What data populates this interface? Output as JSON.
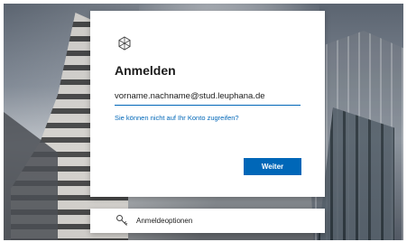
{
  "icons": {
    "logo": "org-logo-icon",
    "options": "key-icon"
  },
  "colors": {
    "accent": "#0067b8",
    "text": "#1b1b1b",
    "card": "#ffffff"
  },
  "signin": {
    "title": "Anmelden",
    "email_value": "vorname.nachname@stud.leuphana.de",
    "help_link": "Sie können nicht auf Ihr Konto zugreifen?",
    "next_button": "Weiter"
  },
  "options": {
    "label": "Anmeldeoptionen"
  }
}
